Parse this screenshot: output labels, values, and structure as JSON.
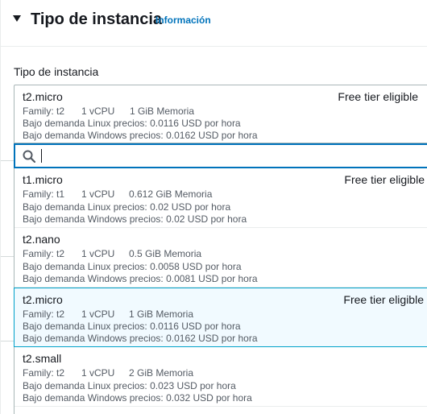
{
  "section": {
    "title": "Tipo de instancia",
    "info_link": "Información"
  },
  "field": {
    "label": "Tipo de instancia"
  },
  "selected": {
    "name": "t2.micro",
    "free_tier": "Free tier eligible",
    "family": "Family: t2",
    "vcpu": "1 vCPU",
    "memory": "1 GiB Memoria",
    "linux": "Bajo demanda Linux precios: 0.0116 USD por hora",
    "windows": "Bajo demanda Windows precios: 0.0162 USD por hora"
  },
  "search": {
    "value": ""
  },
  "options": [
    {
      "name": "t1.micro",
      "free_tier": "Free tier eligible",
      "family": "Family: t1",
      "vcpu": "1 vCPU",
      "memory": "0.612 GiB Memoria",
      "linux": "Bajo demanda Linux precios: 0.02 USD por hora",
      "windows": "Bajo demanda Windows precios: 0.02 USD por hora"
    },
    {
      "name": "t2.nano",
      "free_tier": "",
      "family": "Family: t2",
      "vcpu": "1 vCPU",
      "memory": "0.5 GiB Memoria",
      "linux": "Bajo demanda Linux precios: 0.0058 USD por hora",
      "windows": "Bajo demanda Windows precios: 0.0081 USD por hora"
    },
    {
      "name": "t2.micro",
      "free_tier": "Free tier eligible",
      "family": "Family: t2",
      "vcpu": "1 vCPU",
      "memory": "1 GiB Memoria",
      "linux": "Bajo demanda Linux precios: 0.0116 USD por hora",
      "windows": "Bajo demanda Windows precios: 0.0162 USD por hora"
    },
    {
      "name": "t2.small",
      "free_tier": "",
      "family": "Family: t2",
      "vcpu": "1 vCPU",
      "memory": "2 GiB Memoria",
      "linux": "Bajo demanda Linux precios: 0.023 USD por hora",
      "windows": "Bajo demanda Windows precios: 0.032 USD por hora"
    }
  ],
  "icons": {
    "caret": "caret-down-icon",
    "search": "search-icon"
  },
  "colors": {
    "link": "#0073bb",
    "focus_border": "#0073bb",
    "selected_bg": "#f1faff",
    "selected_border": "#00a1c9"
  }
}
